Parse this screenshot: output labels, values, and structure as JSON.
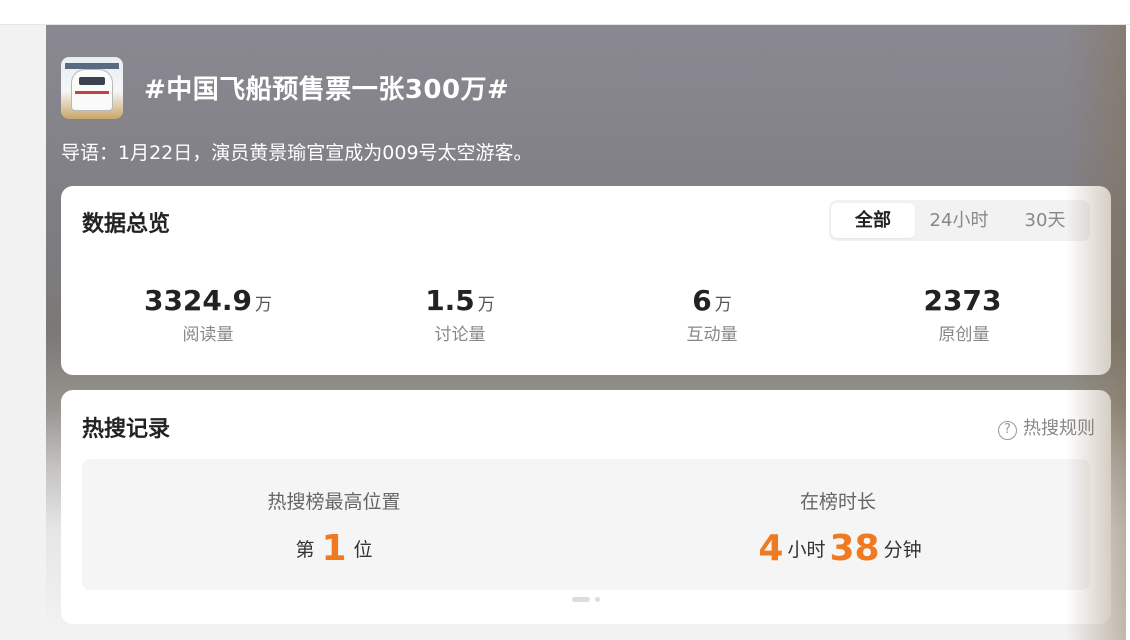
{
  "topic": {
    "title": "#中国飞船预售票一张300万#",
    "intro": "导语：1月22日，演员黄景瑜官宣成为009号太空游客。",
    "thumbnail_icon": "spacecraft-thumbnail"
  },
  "overview": {
    "title": "数据总览",
    "tabs": [
      {
        "label": "全部",
        "active": true
      },
      {
        "label": "24小时",
        "active": false
      },
      {
        "label": "30天",
        "active": false
      }
    ],
    "stats": [
      {
        "value": "3324.9",
        "unit": "万",
        "label": "阅读量"
      },
      {
        "value": "1.5",
        "unit": "万",
        "label": "讨论量"
      },
      {
        "value": "6",
        "unit": "万",
        "label": "互动量"
      },
      {
        "value": "2373",
        "unit": "",
        "label": "原创量"
      }
    ]
  },
  "hot_search": {
    "title": "热搜记录",
    "rules_label": "热搜规则",
    "rules_icon": "question-icon",
    "peak": {
      "label": "热搜榜最高位置",
      "prefix": "第",
      "value": "1",
      "suffix": "位"
    },
    "duration": {
      "label": "在榜时长",
      "hours": "4",
      "hours_unit": "小时",
      "minutes": "38",
      "minutes_unit": "分钟"
    }
  },
  "colors": {
    "accent": "#f07a22",
    "card_bg": "#ffffff",
    "inner_bg": "#f5f5f5"
  }
}
